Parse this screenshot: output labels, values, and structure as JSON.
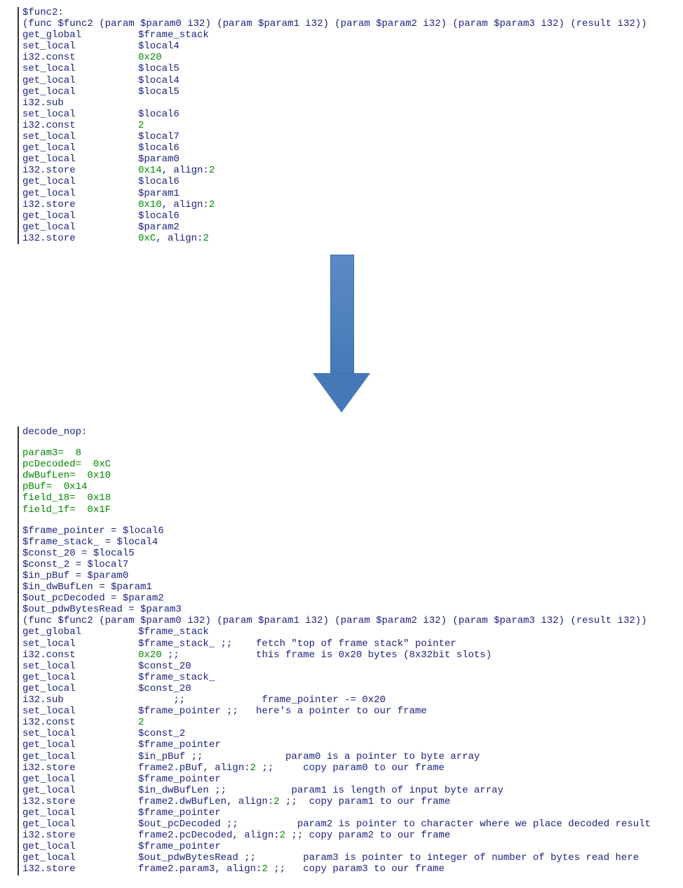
{
  "top": {
    "title": "$func2:",
    "sig": "(func $func2 (param $param0 i32) (param $param1 i32) (param $param2 i32) (param $param3 i32) (result i32))",
    "lines": [
      {
        "i": "get_global",
        "o": "$frame_stack"
      },
      {
        "i": "set_local",
        "o": "$local4"
      },
      {
        "i": "i32.const",
        "o": "0x20",
        "g": true
      },
      {
        "i": "set_local",
        "o": "$local5"
      },
      {
        "i": "get_local",
        "o": "$local4"
      },
      {
        "i": "get_local",
        "o": "$local5"
      },
      {
        "i": "i32.sub",
        "o": ""
      },
      {
        "i": "set_local",
        "o": "$local6"
      },
      {
        "i": "i32.const",
        "o": "2",
        "g": true
      },
      {
        "i": "set_local",
        "o": "$local7"
      },
      {
        "i": "get_local",
        "o": "$local6"
      },
      {
        "i": "get_local",
        "o": "$param0"
      },
      {
        "i": "i32.store",
        "o": "0x14, align:2",
        "g": true,
        "mix": true,
        "gpart": "0x14",
        "bpart": ", align:",
        "gpart2": "2"
      },
      {
        "i": "get_local",
        "o": "$local6"
      },
      {
        "i": "get_local",
        "o": "$param1"
      },
      {
        "i": "i32.store",
        "o": "0x10, align:2",
        "g": true,
        "mix": true,
        "gpart": "0x10",
        "bpart": ", align:",
        "gpart2": "2"
      },
      {
        "i": "get_local",
        "o": "$local6"
      },
      {
        "i": "get_local",
        "o": "$param2"
      },
      {
        "i": "i32.store",
        "o": "0xC, align:2",
        "g": true,
        "mix": true,
        "gpart": "0xC",
        "bpart": ", align:",
        "gpart2": "2"
      }
    ]
  },
  "bottom": {
    "title": "decode_nop:",
    "vars": [
      {
        "n": "param3=",
        "v": "  8"
      },
      {
        "n": "pcDecoded=",
        "v": "  0xC"
      },
      {
        "n": "dwBufLen=",
        "v": "  0x10"
      },
      {
        "n": "pBuf=",
        "v": "  0x14"
      },
      {
        "n": "field_18=",
        "v": "  0x18"
      },
      {
        "n": "field_1f=",
        "v": "  0x1F"
      }
    ],
    "assigns": [
      "$frame_pointer = $local6",
      "$frame_stack_ = $local4",
      "$const_20 = $local5",
      "$const_2 = $local7",
      "$in_pBuf = $param0",
      "$in_dwBufLen = $param1",
      "$out_pcDecoded = $param2",
      "$out_pdwBytesRead = $param3"
    ],
    "sig": "(func $func2 (param $param0 i32) (param $param1 i32) (param $param2 i32) (param $param3 i32) (result i32))",
    "lines": [
      {
        "i": "get_global",
        "o": "$frame_stack",
        "c": ""
      },
      {
        "i": "set_local",
        "o": "$frame_stack_ ;;",
        "c": "    fetch \"top of frame stack\" pointer"
      },
      {
        "i": "i32.const",
        "o": "0x20 ;;",
        "g": true,
        "gpart": "0x20",
        "bpart": " ;;",
        "c": "             this frame is 0x20 bytes (8x32bit slots)"
      },
      {
        "i": "set_local",
        "o": "$const_20",
        "c": ""
      },
      {
        "i": "get_local",
        "o": "$frame_stack_",
        "c": ""
      },
      {
        "i": "get_local",
        "o": "$const_20",
        "c": ""
      },
      {
        "i": "i32.sub",
        "o": "      ;;",
        "c": "             frame_pointer -= 0x20"
      },
      {
        "i": "set_local",
        "o": "$frame_pointer ;;",
        "c": "   here's a pointer to our frame"
      },
      {
        "i": "i32.const",
        "o": "2",
        "g": true,
        "c": ""
      },
      {
        "i": "set_local",
        "o": "$const_2",
        "c": ""
      },
      {
        "i": "get_local",
        "o": "$frame_pointer",
        "c": ""
      },
      {
        "i": "get_local",
        "o": "$in_pBuf ;;",
        "c": "              param0 is a pointer to byte array"
      },
      {
        "i": "i32.store",
        "o": "frame2.pBuf, align:2 ;;",
        "mix": true,
        "bpart1": "frame2.pBuf, align:",
        "gpart": "2",
        "bpart2": " ;;",
        "c": "     copy param0 to our frame"
      },
      {
        "i": "get_local",
        "o": "$frame_pointer",
        "c": ""
      },
      {
        "i": "get_local",
        "o": "$in_dwBufLen ;;",
        "c": "           param1 is length of input byte array"
      },
      {
        "i": "i32.store",
        "o": "frame2.dwBufLen, align:2 ;;",
        "mix": true,
        "bpart1": "frame2.dwBufLen, align:",
        "gpart": "2",
        "bpart2": " ;;",
        "c": "  copy param1 to our frame"
      },
      {
        "i": "get_local",
        "o": "$frame_pointer",
        "c": ""
      },
      {
        "i": "get_local",
        "o": "$out_pcDecoded ;;",
        "c": "          param2 is pointer to character where we place decoded result"
      },
      {
        "i": "i32.store",
        "o": "frame2.pcDecoded, align:2 ;;",
        "mix": true,
        "bpart1": "frame2.pcDecoded, align:",
        "gpart": "2",
        "bpart2": " ;;",
        "c": " copy param2 to our frame"
      },
      {
        "i": "get_local",
        "o": "$frame_pointer",
        "c": ""
      },
      {
        "i": "get_local",
        "o": "$out_pdwBytesRead ;;",
        "c": "        param3 is pointer to integer of number of bytes read here"
      },
      {
        "i": "i32.store",
        "o": "frame2.param3, align:2 ;;",
        "mix": true,
        "bpart1": "frame2.param3, align:",
        "gpart": "2",
        "bpart2": " ;;",
        "c": "   copy param3 to our frame"
      }
    ]
  }
}
